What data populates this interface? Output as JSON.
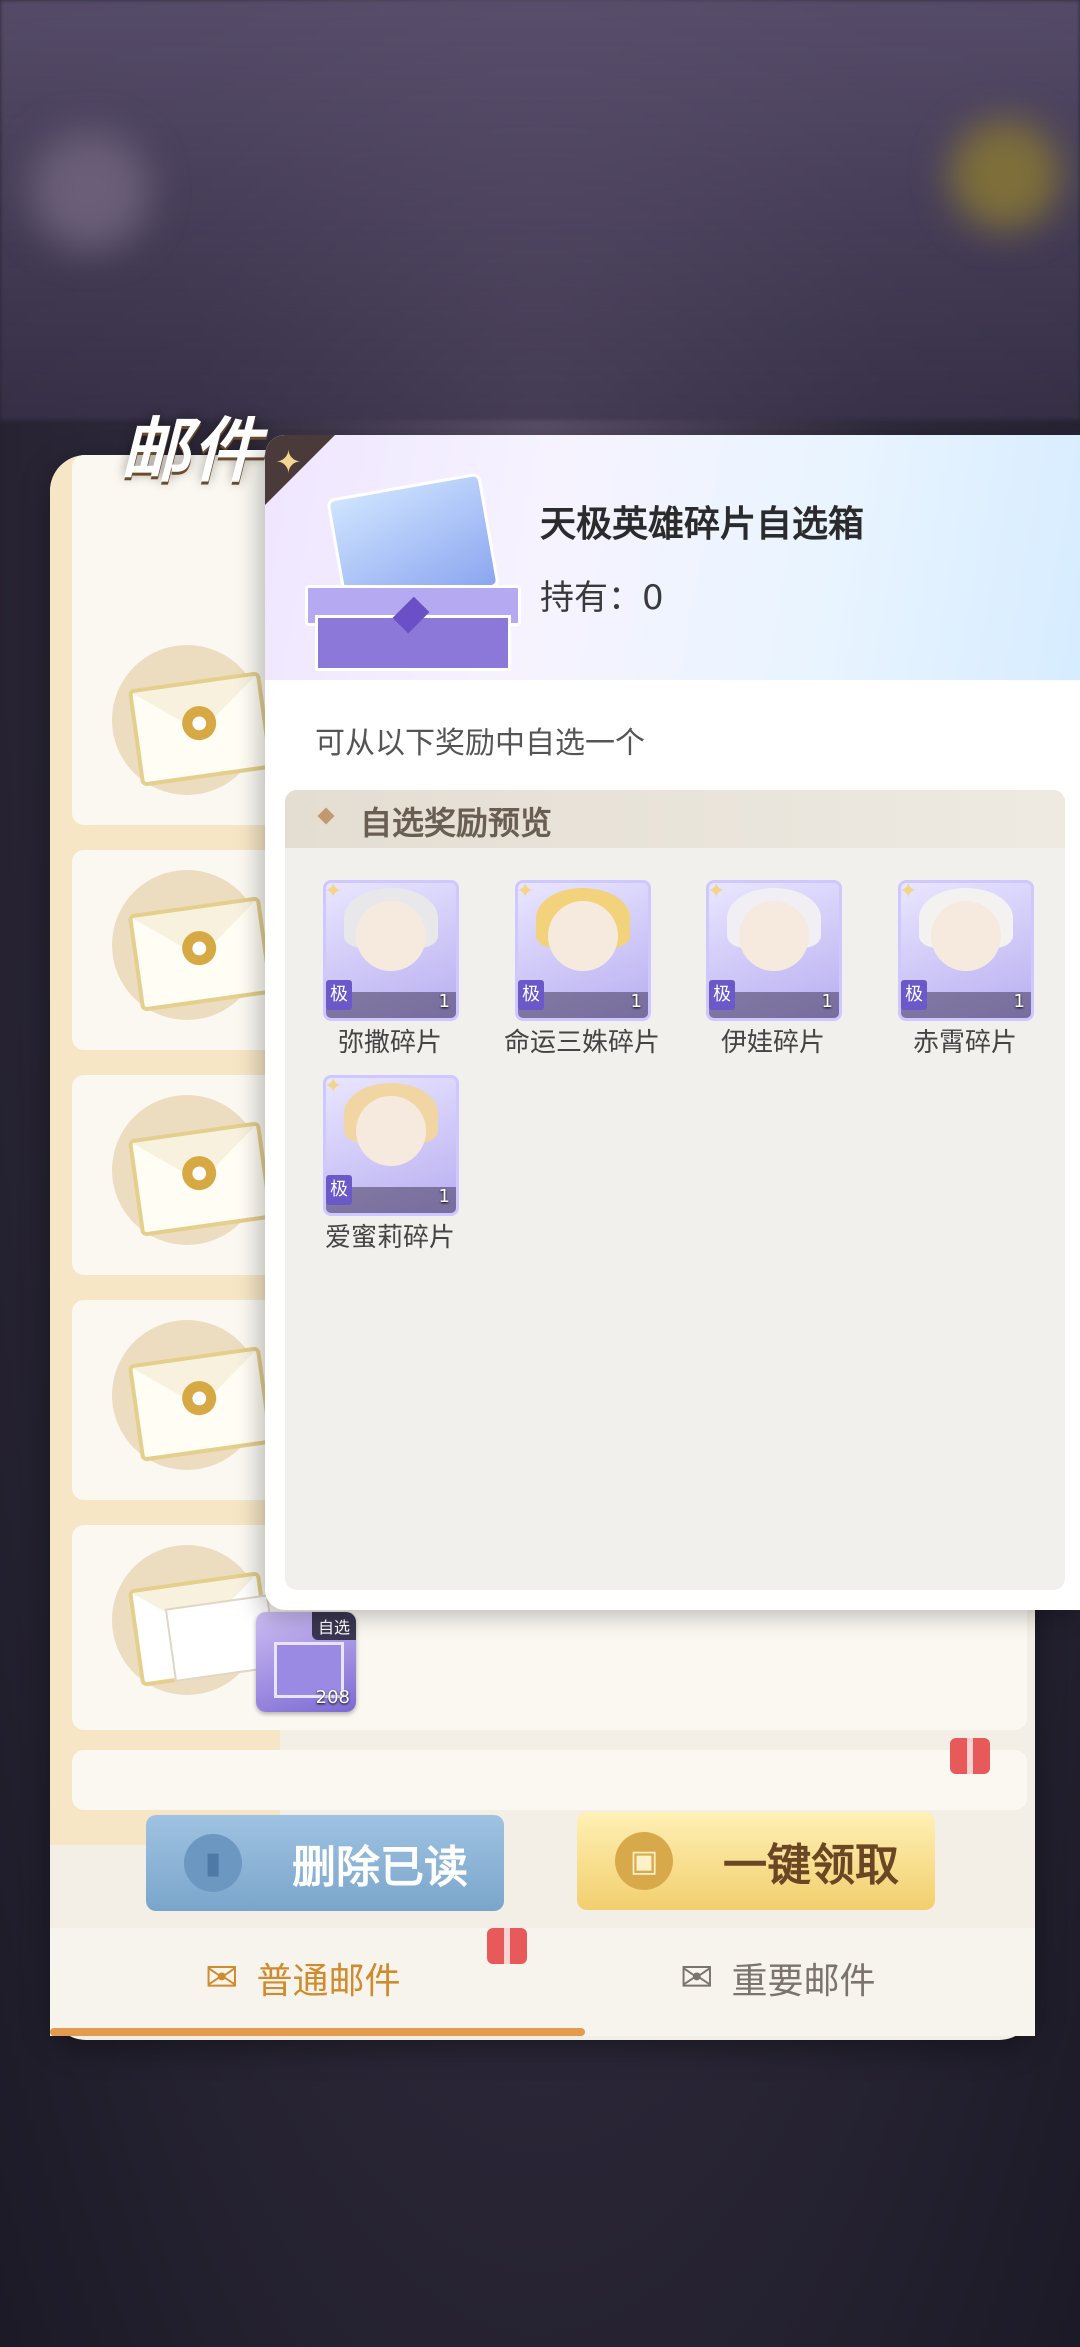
{
  "mail": {
    "title": "邮件",
    "buttons": {
      "delete_read": "删除已读",
      "claim_all": "一键领取"
    },
    "tabs": [
      {
        "label": "普通邮件",
        "active": true
      },
      {
        "label": "重要邮件",
        "active": false
      }
    ],
    "attachment": {
      "tag": "自选",
      "count": "208"
    }
  },
  "popup": {
    "item_name": "天极英雄碎片自选箱",
    "owned_label": "持有：",
    "owned_value": "0",
    "description": "可从以下奖励中自选一个",
    "preview_title": "自选奖励预览",
    "rewards": [
      {
        "name": "弥撒碎片",
        "qty": "1",
        "badge": "极",
        "hair_color": "#e8e8ea"
      },
      {
        "name": "命运三姝碎片",
        "qty": "1",
        "badge": "极",
        "hair_color": "#f2d27a"
      },
      {
        "name": "伊娃碎片",
        "qty": "1",
        "badge": "极",
        "hair_color": "#f1eef4"
      },
      {
        "name": "赤霄碎片",
        "qty": "1",
        "badge": "极",
        "hair_color": "#f4f1f1"
      },
      {
        "name": "爱蜜莉碎片",
        "qty": "1",
        "badge": "极",
        "hair_color": "#f1d6a4"
      }
    ]
  },
  "colors": {
    "accent_orange": "#e49b4d",
    "delete_blue": "#7aa5cb",
    "claim_gold": "#f2cf6e"
  }
}
